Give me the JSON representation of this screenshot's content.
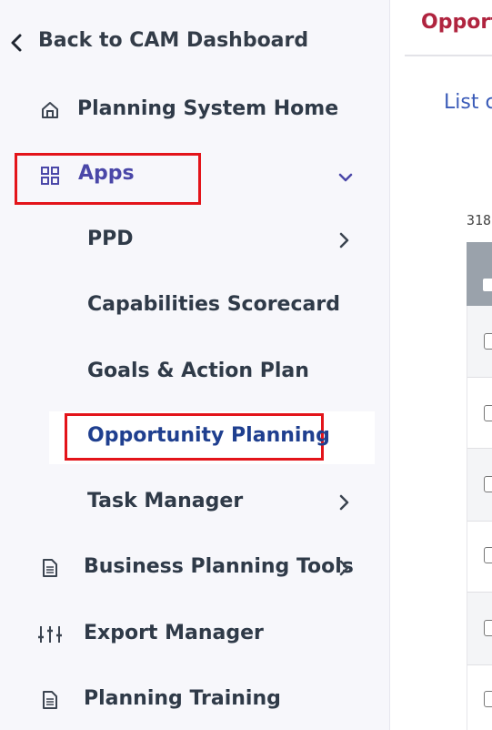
{
  "sidebar": {
    "back_label": "Back to CAM Dashboard",
    "items": [
      {
        "label": "Planning System Home",
        "icon": "home-icon"
      },
      {
        "label": "Apps",
        "icon": "grid-icon"
      },
      {
        "label": "PPD"
      },
      {
        "label": "Capabilities Scorecard"
      },
      {
        "label": "Goals & Action Plan"
      },
      {
        "label": "Opportunity Planning"
      },
      {
        "label": "Task Manager"
      },
      {
        "label": "Business Planning Tools",
        "icon": "document-icon"
      },
      {
        "label": "Export Manager",
        "icon": "sliders-icon"
      },
      {
        "label": "Planning Training",
        "icon": "document-icon"
      }
    ]
  },
  "main": {
    "tab_title": "Opport",
    "subtitle": "List c",
    "count": "318"
  },
  "colors": {
    "accent_red": "#e3141a",
    "active_blue": "#1f3f8f",
    "apps_purple": "#4a47a8",
    "tab_red": "#b0243f"
  }
}
